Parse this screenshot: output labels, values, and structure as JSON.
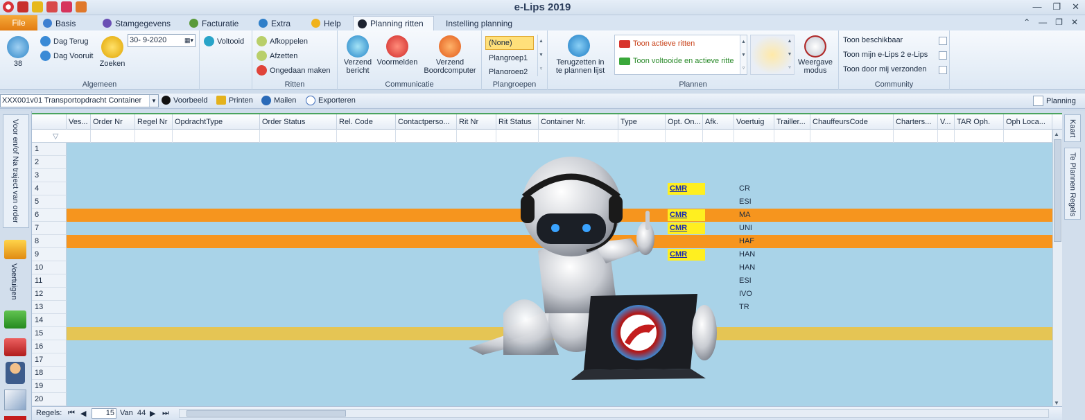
{
  "window": {
    "title": "e-Lips 2019"
  },
  "tabs": [
    {
      "label": "File"
    },
    {
      "label": "Basis"
    },
    {
      "label": "Stamgegevens"
    },
    {
      "label": "Facturatie"
    },
    {
      "label": "Extra"
    },
    {
      "label": "Help"
    },
    {
      "label": "Planning ritten"
    },
    {
      "label": "Instelling planning"
    }
  ],
  "ribbon": {
    "algemeen": {
      "count": "38",
      "dag_terug": "Dag Terug",
      "dag_vooruit": "Dag Vooruit",
      "zoeken": "Zoeken",
      "date": "30- 9-2020",
      "label": "Algemeen"
    },
    "voltooid": "Voltooid",
    "ritten": {
      "afkoppelen": "Afkoppelen",
      "afzetten": "Afzetten",
      "ongedaan": "Ongedaan maken",
      "label": "Ritten"
    },
    "communicatie": {
      "verzend_bericht": [
        "Verzend",
        "bericht"
      ],
      "voormelden": "Voormelden",
      "verzend_bc": [
        "Verzend",
        "Boordcomputer"
      ],
      "label": "Communicatie"
    },
    "plangroepen": {
      "items": [
        "(None)",
        "Plangroep1",
        "Plangroep2"
      ],
      "label": "Plangroepen"
    },
    "plannen": {
      "terugzetten": [
        "Terugzetten in",
        "te plannen lijst"
      ],
      "toon_actieve": "Toon actieve ritten",
      "toon_voltooide": "Toon voltooide en actieve ritte",
      "weergave": [
        "Weergave",
        "modus"
      ],
      "label": "Plannen"
    },
    "community": {
      "toon_beschikbaar": "Toon beschikbaar",
      "toon_mijn": "Toon mijn e-Lips 2 e-Lips",
      "toon_door": "Toon door mij verzonden",
      "label": "Community"
    }
  },
  "toolbar": {
    "report_select": "XXX001v01 Transportopdracht Container",
    "voorbeeld": "Voorbeeld",
    "printen": "Printen",
    "mailen": "Mailen",
    "exporteren": "Exporteren",
    "planning": "Planning"
  },
  "sidepanel": {
    "voor_en_na": "Voor en/of Na traject van order",
    "voertuigen": "Voertuigen",
    "kaart": "Kaart",
    "te_plannen": "Te Plannen Regels"
  },
  "grid": {
    "columns": [
      "Ves...",
      "Order Nr",
      "Regel Nr",
      "OpdrachtType",
      "Order Status",
      "Rel. Code",
      "Contactperso...",
      "Rit Nr",
      "Rit Status",
      "Container Nr.",
      "Type",
      "Opt. On...",
      "Afk.",
      "Voertuig",
      "Trailler...",
      "ChauffeursCode",
      "Charters...",
      "V...",
      "TAR Oph.",
      "Oph Loca..."
    ],
    "row_numbers": [
      "1",
      "2",
      "3",
      "4",
      "5",
      "6",
      "7",
      "8",
      "9",
      "10",
      "11",
      "12",
      "13",
      "14",
      "15",
      "16",
      "17",
      "18",
      "19",
      "20"
    ],
    "cmr_label": "CMR",
    "voertuig_values": {
      "4": "CR",
      "5": "ESI",
      "6": "MA",
      "7": "UNI",
      "8": "HAF",
      "9": "HAN",
      "10": "HAN",
      "11": "ESI",
      "12": "IVO",
      "13": "TR"
    }
  },
  "statusbar": {
    "regels": "Regels:",
    "current": "15",
    "van": "Van",
    "total": "44"
  },
  "colors": {
    "orange_row": "#f6951e",
    "yellow_band": "#f0c23a",
    "accent": "#f18c1e"
  }
}
